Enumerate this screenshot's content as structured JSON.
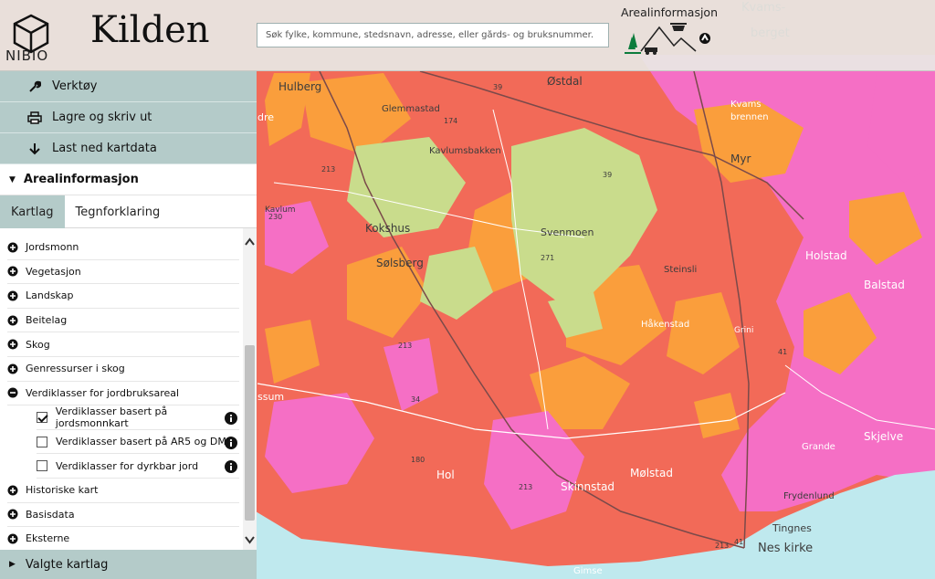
{
  "header": {
    "logo_text": "NIBIO",
    "app_title": "Kilden",
    "search_placeholder": "Søk fylke, kommune, stedsnavn, adresse, eller gårds- og bruksnummer.",
    "theme_title": "Arealinformasjon"
  },
  "sidebar": {
    "tools": [
      {
        "label": "Verktøy",
        "icon": "wrench-icon"
      },
      {
        "label": "Lagre og skriv ut",
        "icon": "printer-icon"
      },
      {
        "label": "Last ned kartdata",
        "icon": "download-arrow-icon"
      }
    ],
    "section_title": "Arealinformasjon",
    "tabs": [
      {
        "label": "Kartlag",
        "active": true
      },
      {
        "label": "Tegnforklaring",
        "active": false
      }
    ],
    "layers": [
      {
        "label": "Jordsmonn",
        "expanded": false
      },
      {
        "label": "Vegetasjon",
        "expanded": false
      },
      {
        "label": "Landskap",
        "expanded": false
      },
      {
        "label": "Beitelag",
        "expanded": false
      },
      {
        "label": "Skog",
        "expanded": false
      },
      {
        "label": "Genressurser i skog",
        "expanded": false
      },
      {
        "label": "Verdiklasser for jordbruksareal",
        "expanded": true
      }
    ],
    "sublayers": [
      {
        "label": "Verdiklasser basert på jordsmonnkart",
        "checked": true
      },
      {
        "label": "Verdiklasser basert på AR5 og DMK",
        "checked": false
      },
      {
        "label": "Verdiklasser for dyrkbar jord",
        "checked": false
      }
    ],
    "layers_after": [
      {
        "label": "Historiske kart",
        "expanded": false
      },
      {
        "label": "Basisdata",
        "expanded": false
      },
      {
        "label": "Eksterne",
        "expanded": false
      }
    ],
    "selected_layers_label": "Valgte kartlag"
  },
  "map": {
    "place_names": [
      "Kvams-",
      "berget",
      "Hulberg",
      "Østdal",
      "Glemmastad",
      "Kvams",
      "brennen",
      "Kavlumsbakken",
      "Myr",
      "Kavlum",
      "Kokshus",
      "Svenmoen",
      "Holstad",
      "Balstad",
      "Sølsberg",
      "Steinsli",
      "Håkenstad",
      "Grini",
      "Skjelve",
      "Grande",
      "Hol",
      "Skinnstad",
      "Mølstad",
      "Frydenlund",
      "Tingnes",
      "Nes kirke",
      "Gimse",
      "dre",
      "ssum"
    ],
    "road_numbers": [
      "39",
      "174",
      "213",
      "230",
      "39",
      "271",
      "213",
      "34",
      "41",
      "180",
      "213",
      "213",
      "41"
    ],
    "colors": {
      "red": "#f26a58",
      "orange": "#fa9e3c",
      "pink": "#f56fc5",
      "lightgreen": "#c9dc8c",
      "sea": "#bfe9ee"
    }
  }
}
